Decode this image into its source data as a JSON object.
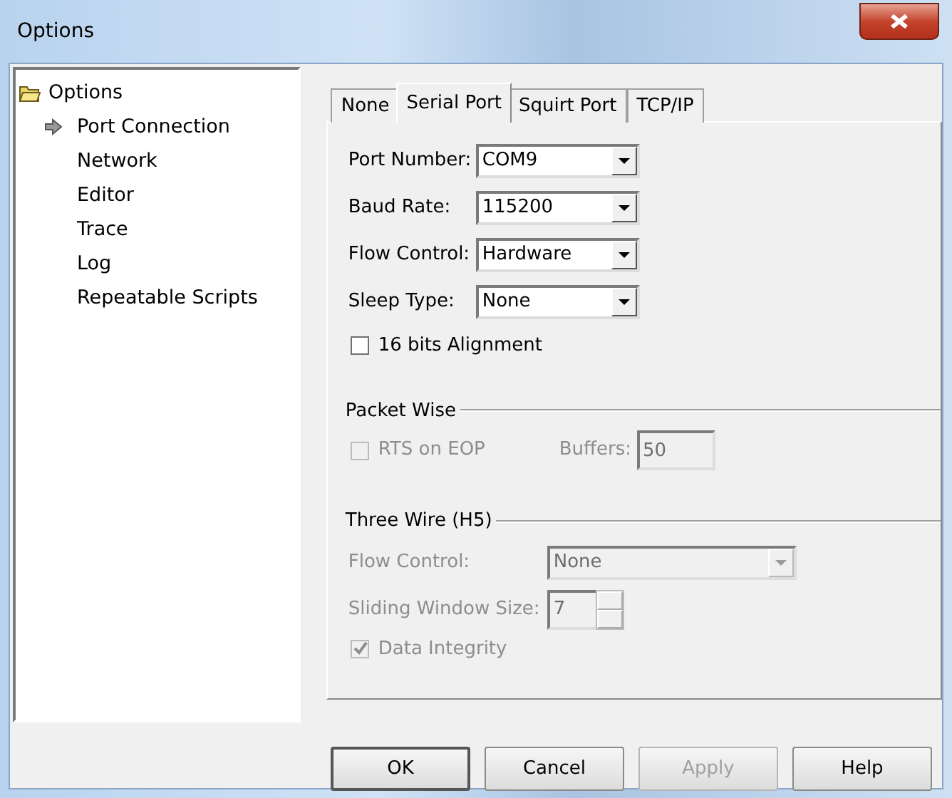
{
  "window": {
    "title": "Options"
  },
  "tree": {
    "label": "Options",
    "expanded": true,
    "children": [
      {
        "label": "Port Connection",
        "selected": true
      },
      {
        "label": "Network",
        "selected": false
      },
      {
        "label": "Editor",
        "selected": false
      },
      {
        "label": "Trace",
        "selected": false
      },
      {
        "label": "Log",
        "selected": false
      },
      {
        "label": "Repeatable Scripts",
        "selected": false
      }
    ]
  },
  "tabs": [
    {
      "label": "None",
      "selected": false
    },
    {
      "label": "Serial Port",
      "selected": true
    },
    {
      "label": "Squirt Port",
      "selected": false
    },
    {
      "label": "TCP/IP",
      "selected": false
    }
  ],
  "serial": {
    "fields": [
      {
        "label": "Port Number:",
        "value": "COM9"
      },
      {
        "label": "Baud Rate:",
        "value": "115200"
      },
      {
        "label": "Flow Control:",
        "value": "Hardware"
      },
      {
        "label": "Sleep Type:",
        "value": "None"
      }
    ],
    "alignment": {
      "label": "16 bits Alignment",
      "checked": false,
      "disabled": false
    }
  },
  "packet_wise": {
    "title": "Packet Wise",
    "rts": {
      "label": "RTS on EOP",
      "checked": false,
      "disabled": true
    },
    "buffers": {
      "label": "Buffers:",
      "value": "50",
      "disabled": true
    }
  },
  "three_wire": {
    "title": "Three Wire (H5)",
    "flow_control": {
      "label": "Flow Control:",
      "value": "None",
      "disabled": true
    },
    "window_size": {
      "label": "Sliding Window Size:",
      "value": "7",
      "disabled": true
    },
    "data_integrity": {
      "label": "Data Integrity",
      "checked": true,
      "disabled": true
    }
  },
  "buttons": [
    {
      "label": "OK",
      "disabled": false,
      "default": true
    },
    {
      "label": "Cancel",
      "disabled": false,
      "default": false
    },
    {
      "label": "Apply",
      "disabled": true,
      "default": false
    },
    {
      "label": "Help",
      "disabled": false,
      "default": false
    }
  ]
}
